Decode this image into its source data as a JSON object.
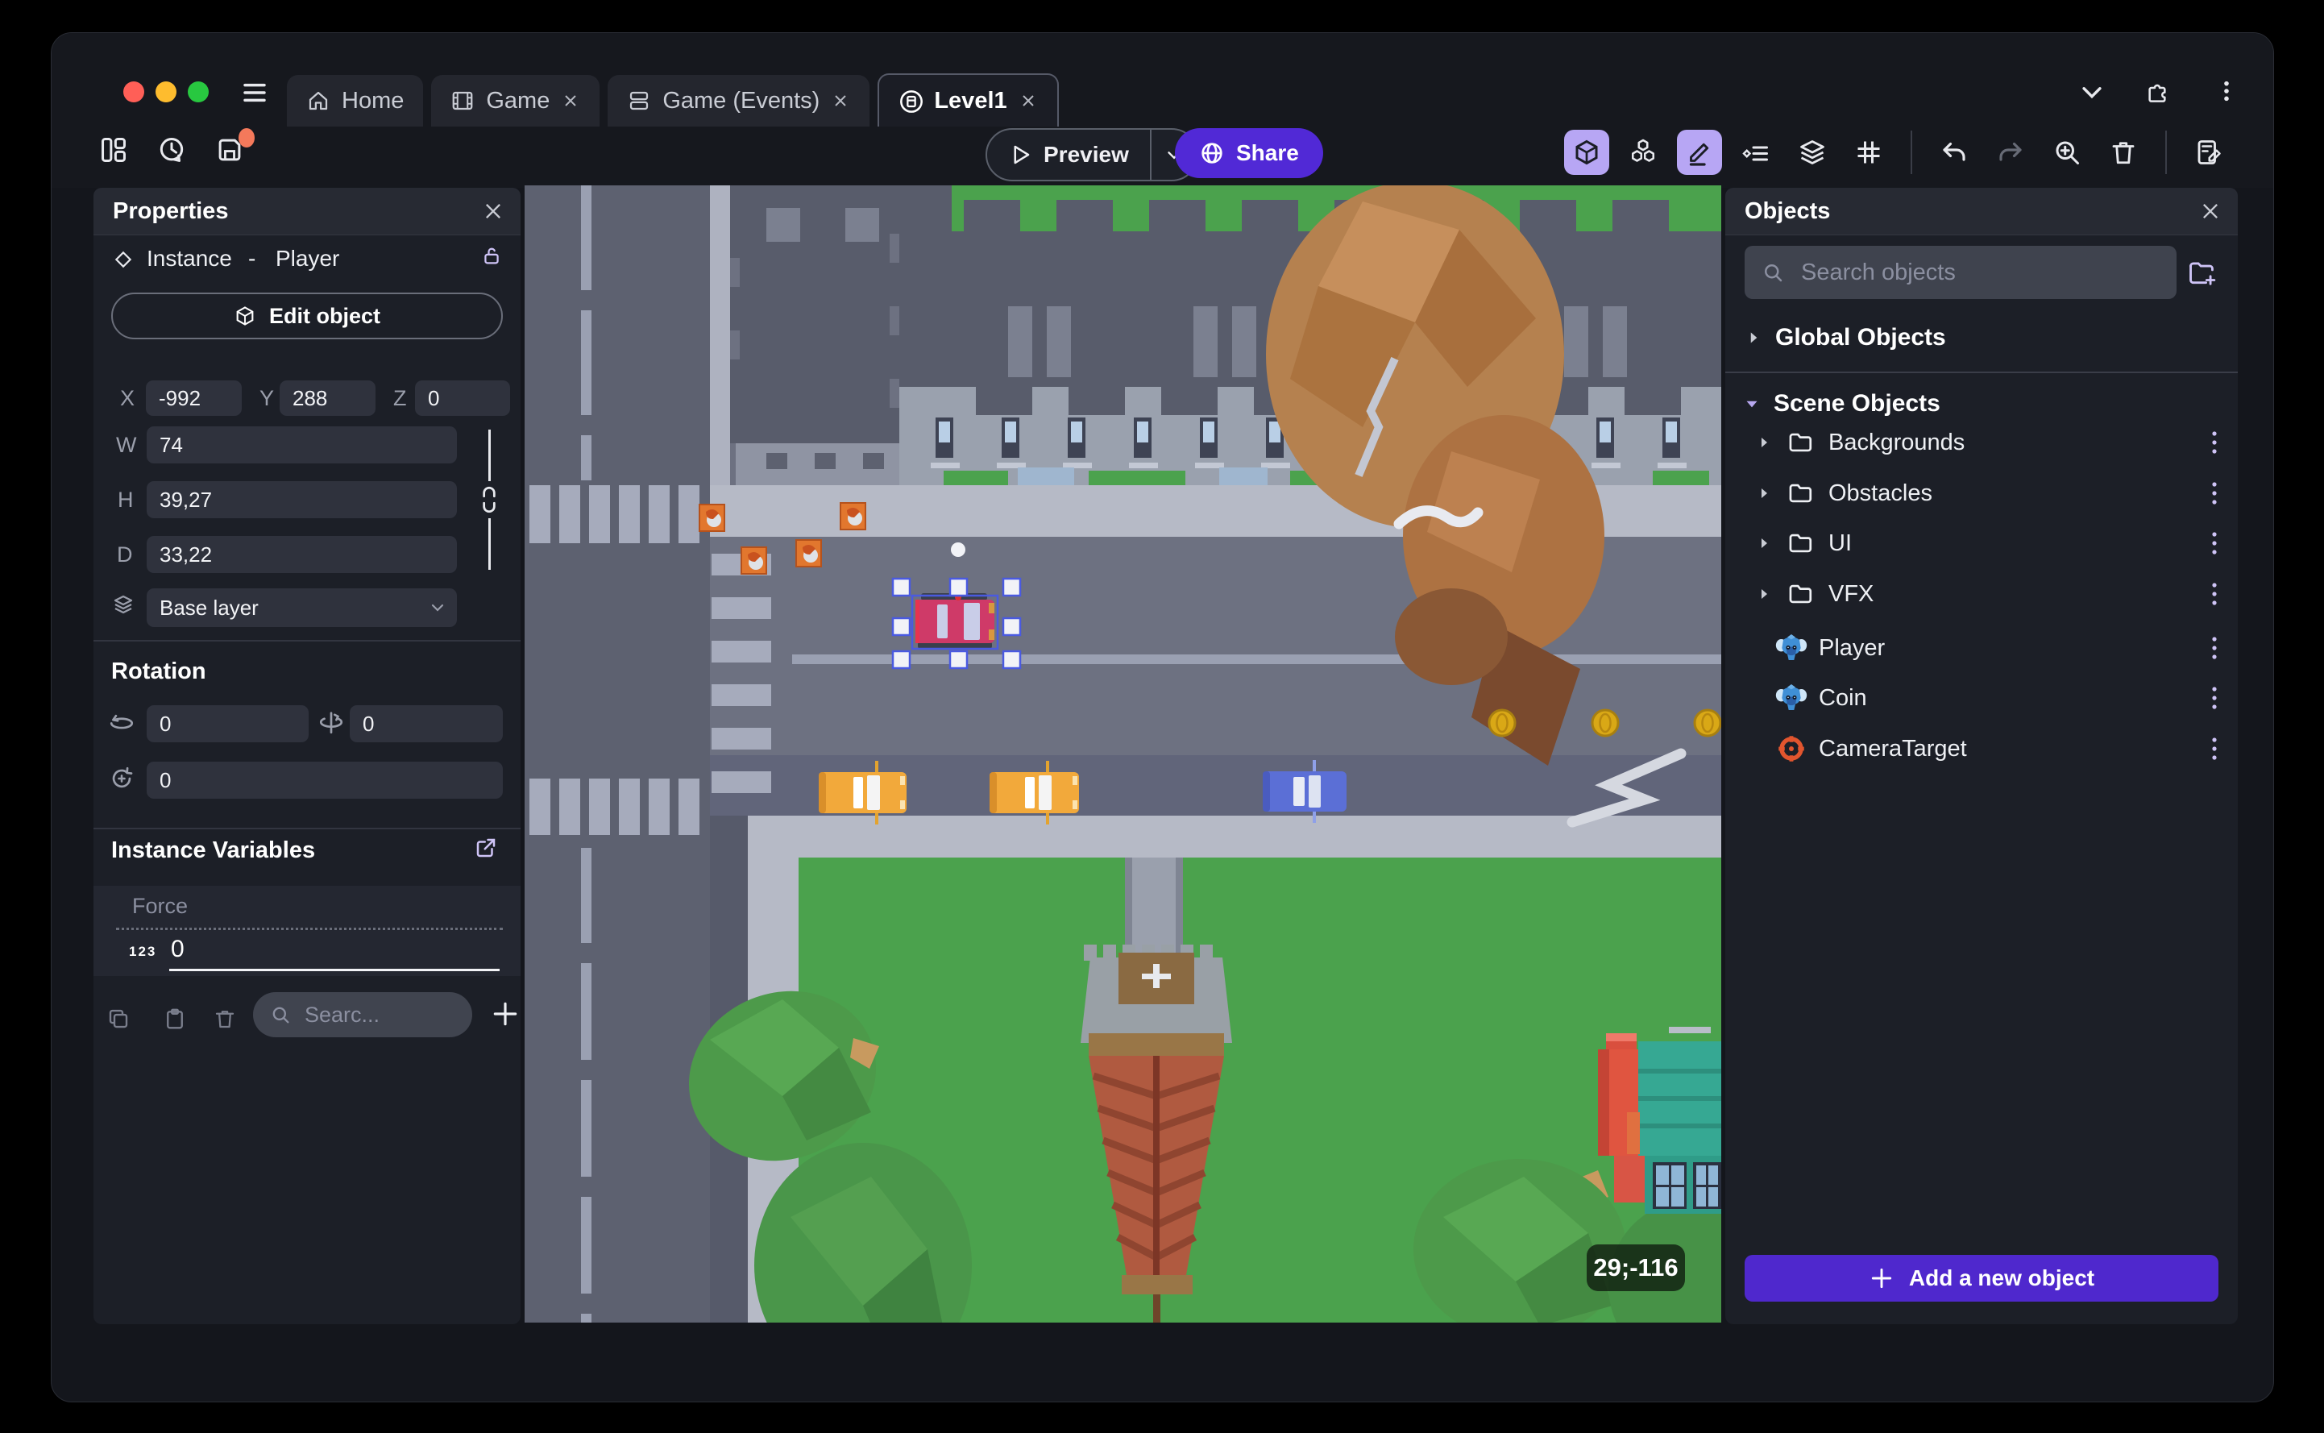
{
  "window_controls": {
    "tabs": [
      {
        "label": "Home"
      },
      {
        "label": "Game"
      },
      {
        "label": "Game (Events)"
      },
      {
        "label": "Level1"
      }
    ]
  },
  "toolbar": {
    "preview_label": "Preview",
    "share_label": "Share"
  },
  "properties_panel": {
    "title": "Properties",
    "instance_label": "Instance",
    "separator": "-",
    "object_name": "Player",
    "edit_object_label": "Edit object",
    "x_label": "X",
    "x_value": "-992",
    "y_label": "Y",
    "y_value": "288",
    "z_label": "Z",
    "z_value": "0",
    "w_label": "W",
    "w_value": "74",
    "h_label": "H",
    "h_value": "39,27",
    "d_label": "D",
    "d_value": "33,22",
    "layer_value": "Base layer",
    "rotation_title": "Rotation",
    "rotation_x": "0",
    "rotation_y": "0",
    "rotation_z": "0",
    "variables_title": "Instance Variables",
    "variable_name": "Force",
    "variable_type_badge": "123",
    "variable_value": "0",
    "variables_search_placeholder": "Searc..."
  },
  "objects_panel": {
    "title": "Objects",
    "search_placeholder": "Search objects",
    "global_group_label": "Global Objects",
    "scene_group_label": "Scene Objects",
    "folders": [
      {
        "label": "Backgrounds"
      },
      {
        "label": "Obstacles"
      },
      {
        "label": "UI"
      },
      {
        "label": "VFX"
      }
    ],
    "objects": [
      {
        "label": "Player"
      },
      {
        "label": "Coin"
      },
      {
        "label": "CameraTarget"
      }
    ],
    "add_button_label": "Add a new object"
  },
  "canvas": {
    "coordinates_badge": "29;-116"
  },
  "colors": {
    "accent_purple": "#4f28cd",
    "active_tool_bg": "#b7a6f4",
    "unsaved_dot": "#f4795b",
    "traffic_red": "#ff5f57",
    "traffic_yellow": "#febc2e",
    "traffic_green": "#28c840",
    "selection_blue": "#4a5ae0",
    "grass_green": "#4ba24d",
    "road_gray": "#6d7181"
  }
}
